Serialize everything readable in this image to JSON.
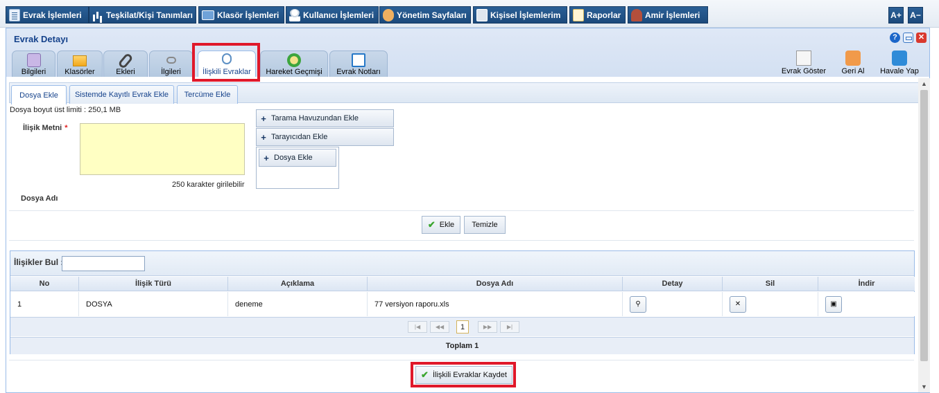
{
  "topmenu": {
    "items": [
      {
        "label": "Evrak İşlemleri",
        "icon": "document-icon"
      },
      {
        "label": "Teşkilat/Kişi Tanımları",
        "icon": "org-chart-icon"
      },
      {
        "label": "Klasör İşlemleri",
        "icon": "folder-icon"
      },
      {
        "label": "Kullanıcı İşlemleri",
        "icon": "user-icon"
      },
      {
        "label": "Yönetim Sayfaları",
        "icon": "admin-icon"
      },
      {
        "label": "Kişisel İşlemlerim",
        "icon": "personal-icon"
      },
      {
        "label": "Raporlar",
        "icon": "report-icon"
      },
      {
        "label": "Amir İşlemleri",
        "icon": "chief-icon"
      }
    ],
    "font_increase": "A+",
    "font_decrease": "A−"
  },
  "panel": {
    "title": "Evrak Detayı",
    "help": "?",
    "close": "✕"
  },
  "tabs": [
    {
      "label": "Bilgileri",
      "icon": "info-book-icon"
    },
    {
      "label": "Klasörler",
      "icon": "folders-icon"
    },
    {
      "label": "Ekleri",
      "icon": "paperclip-icon"
    },
    {
      "label": "İlgileri",
      "icon": "chain-icon"
    },
    {
      "label": "İlişkili Evraklar",
      "icon": "linked-docs-icon"
    },
    {
      "label": "Hareket Geçmişi",
      "icon": "clock-icon"
    },
    {
      "label": "Evrak Notları",
      "icon": "note-icon"
    }
  ],
  "active_tab": "İlişkili Evraklar",
  "tools": [
    {
      "label": "Evrak Göster",
      "icon": "document-view-icon"
    },
    {
      "label": "Geri Al",
      "icon": "undo-icon"
    },
    {
      "label": "Havale Yap",
      "icon": "transfer-icon"
    }
  ],
  "subtabs": [
    {
      "label": "Dosya Ekle"
    },
    {
      "label": "Sistemde Kayıtlı Evrak Ekle"
    },
    {
      "label": "Tercüme Ekle"
    }
  ],
  "form": {
    "size_limit": "Dosya boyut üst limiti : 250,1 MB",
    "ilisik_metni_label": "İlişik Metni",
    "required_mark": "*",
    "ilisik_metni_value": "",
    "char_counter": "250 karakter girilebilir",
    "dosya_adi_label": "Dosya Adı",
    "add_from_pool": "Tarama Havuzundan Ekle",
    "add_from_scanner": "Tarayıcıdan Ekle",
    "add_file": "Dosya Ekle",
    "ekle_button": "Ekle",
    "temizle_button": "Temizle"
  },
  "grid": {
    "find_label": "İlişikler Bul :",
    "find_value": "",
    "columns": [
      "No",
      "İlişik Türü",
      "Açıklama",
      "Dosya Adı",
      "Detay",
      "Sil",
      "İndir"
    ],
    "rows": [
      {
        "no": "1",
        "type": "DOSYA",
        "desc": "deneme",
        "file": "77 versiyon raporu.xls"
      }
    ],
    "page": "1",
    "total": "Toplam 1"
  },
  "save_button": "İlişkili Evraklar Kaydet",
  "colors": {
    "menu_blue": "#1c4a7c",
    "panel_title": "#15428b",
    "highlight_red": "#e0182a",
    "textarea_yellow": "#ffffc3"
  }
}
